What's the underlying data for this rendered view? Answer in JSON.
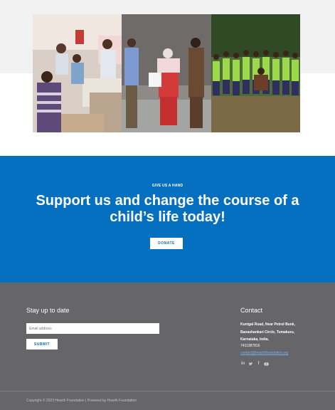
{
  "photos": {
    "items": [
      {
        "alt": "Health camp volunteers checking patients"
      },
      {
        "alt": "Handing over assistance to a woman"
      },
      {
        "alt": "Youth football team posing on the field"
      }
    ]
  },
  "donate": {
    "eyebrow": "GIVE US A HAND",
    "headline": "Support us and change the course of a child’s life today!",
    "button_label": "DONATE"
  },
  "newsletter": {
    "title": "Stay up to date",
    "email_placeholder": "Email address",
    "submit_label": "SUBMIT"
  },
  "contact": {
    "title": "Contact",
    "address_line1": "Kunigal Road, Near Petrol Bunk,",
    "address_line2": "Banashankari Circle, Tumakuru,",
    "address_line3": "Karnataka, India.",
    "phone": "7411387816",
    "email": "contact@hearthfoundation.org",
    "socials": [
      {
        "icon": "linkedin-icon",
        "glyph": "in"
      },
      {
        "icon": "twitter-icon",
        "glyph": "🐦"
      },
      {
        "icon": "facebook-icon",
        "glyph": "f"
      },
      {
        "icon": "youtube-icon",
        "glyph": "▶"
      }
    ]
  },
  "footer": {
    "copyright": "Copyright © 2023 Hearth Foundation | Powered by Hearth Foundation"
  },
  "colors": {
    "primary_blue": "#0670c0",
    "footer_gray": "#666669",
    "link_blue": "#6fb2ee"
  }
}
